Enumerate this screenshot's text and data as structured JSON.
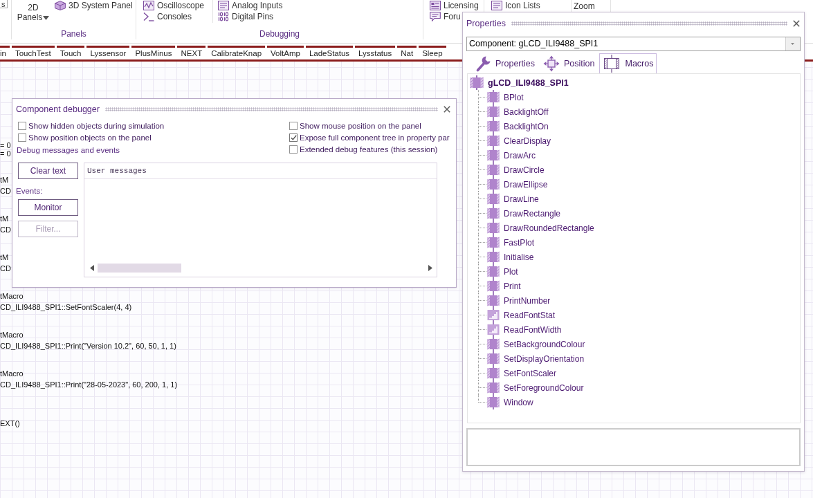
{
  "ribbon": {
    "groups": [
      {
        "columns": [
          [
            {
              "kind": "boxed",
              "label": "s"
            }
          ]
        ]
      },
      {
        "label": "Panels",
        "columns": [
          [
            {
              "kind": "dropdown",
              "label": "2D Panels"
            }
          ],
          [
            {
              "kind": "small",
              "label": "3D System Panel"
            }
          ]
        ]
      },
      {
        "label": "Debugging",
        "columns": [
          [
            {
              "kind": "small",
              "label": "Oscilloscope"
            },
            {
              "kind": "small",
              "label": "Consoles"
            }
          ],
          [
            {
              "kind": "small",
              "label": "Analog Inputs"
            },
            {
              "kind": "small",
              "label": "Digital Pins"
            }
          ]
        ]
      },
      {
        "columns": [
          [
            {
              "kind": "small",
              "label": "Licensing"
            },
            {
              "kind": "small",
              "label": "Foru"
            }
          ]
        ]
      },
      {
        "columns": [
          [
            {
              "kind": "small",
              "label": "Icon Lists"
            }
          ]
        ]
      },
      {
        "columns": [
          [
            {
              "kind": "large",
              "label": "Zoom"
            }
          ]
        ]
      }
    ]
  },
  "tabs": [
    {
      "label": "in",
      "selected": false
    },
    {
      "label": "TouchTest",
      "selected": false
    },
    {
      "label": "Touch",
      "selected": false
    },
    {
      "label": "Lyssensor",
      "selected": false
    },
    {
      "label": "PlusMinus",
      "selected": false
    },
    {
      "label": "NEXT",
      "selected": false
    },
    {
      "label": "CalibrateKnap",
      "selected": false
    },
    {
      "label": "VoltAmp",
      "selected": false
    },
    {
      "label": "LadeStatus",
      "selected": false
    },
    {
      "label": "Lysstatus",
      "selected": false
    },
    {
      "label": "Nat",
      "selected": false
    },
    {
      "label": "Sleep",
      "selected": false
    }
  ],
  "flowchart": {
    "blocks": [
      {
        "title": "= 0",
        "text": "= 0"
      },
      {
        "title": "tM",
        "text": "CD"
      },
      {
        "title": "tM",
        "text": "CD"
      },
      {
        "title": "tM",
        "text": "CD"
      },
      {
        "title": "tMacro",
        "text": "CD_ILI9488_SPI1::SetFontScaler(4, 4)"
      },
      {
        "title": "tMacro",
        "text": "CD_ILI9488_SPI1::Print(\"Version 10.2\", 60, 50, 1, 1)"
      },
      {
        "title": "tMacro",
        "text": "CD_ILI9488_SPI1::Print(\"28-05-2023\", 60, 200, 1, 1)"
      },
      {
        "text": "EXT()"
      }
    ]
  },
  "debugger": {
    "title": "Component debugger",
    "options_left": [
      {
        "label": "Show hidden objects during simulation",
        "checked": false
      },
      {
        "label": "Show position objects on the panel",
        "checked": false
      }
    ],
    "messages_label": "Debug messages and events",
    "options_right": [
      {
        "label": "Show mouse position on the panel",
        "checked": false
      },
      {
        "label": "Expose full component tree in property par",
        "checked": true
      },
      {
        "label": "Extended debug features (this session)",
        "checked": false
      }
    ],
    "buttons": [
      {
        "label": "Clear text",
        "disabled": false
      },
      {
        "label": "Monitor",
        "disabled": false
      },
      {
        "label": "Filter...",
        "disabled": true
      }
    ],
    "events_label": "Events:",
    "log": {
      "header": "User messages"
    }
  },
  "properties_panel": {
    "title": "Properties",
    "component_select": {
      "value": "Component: gLCD_ILI9488_SPI1"
    },
    "tabs": [
      {
        "label": "Properties",
        "selected": false
      },
      {
        "label": "Position",
        "selected": false
      },
      {
        "label": "Macros",
        "selected": true
      }
    ],
    "tree": {
      "label": "gLCD_ILI9488_SPI1",
      "children": [
        {
          "label": "BPlot",
          "kind": "macro"
        },
        {
          "label": "BacklightOff",
          "kind": "macro"
        },
        {
          "label": "BacklightOn",
          "kind": "macro"
        },
        {
          "label": "ClearDisplay",
          "kind": "macro"
        },
        {
          "label": "DrawArc",
          "kind": "macro"
        },
        {
          "label": "DrawCircle",
          "kind": "macro"
        },
        {
          "label": "DrawEllipse",
          "kind": "macro"
        },
        {
          "label": "DrawLine",
          "kind": "macro"
        },
        {
          "label": "DrawRectangle",
          "kind": "macro"
        },
        {
          "label": "DrawRoundedRectangle",
          "kind": "macro"
        },
        {
          "label": "FastPlot",
          "kind": "macro"
        },
        {
          "label": "Initialise",
          "kind": "macro"
        },
        {
          "label": "Plot",
          "kind": "macro"
        },
        {
          "label": "Print",
          "kind": "macro"
        },
        {
          "label": "PrintNumber",
          "kind": "macro"
        },
        {
          "label": "ReadFontStat",
          "kind": "return"
        },
        {
          "label": "ReadFontWidth",
          "kind": "return"
        },
        {
          "label": "SetBackgroundColour",
          "kind": "macro"
        },
        {
          "label": "SetDisplayOrientation",
          "kind": "macro"
        },
        {
          "label": "SetFontScaler",
          "kind": "macro"
        },
        {
          "label": "SetForegroundColour",
          "kind": "macro"
        },
        {
          "label": "Window",
          "kind": "macro"
        }
      ]
    }
  }
}
